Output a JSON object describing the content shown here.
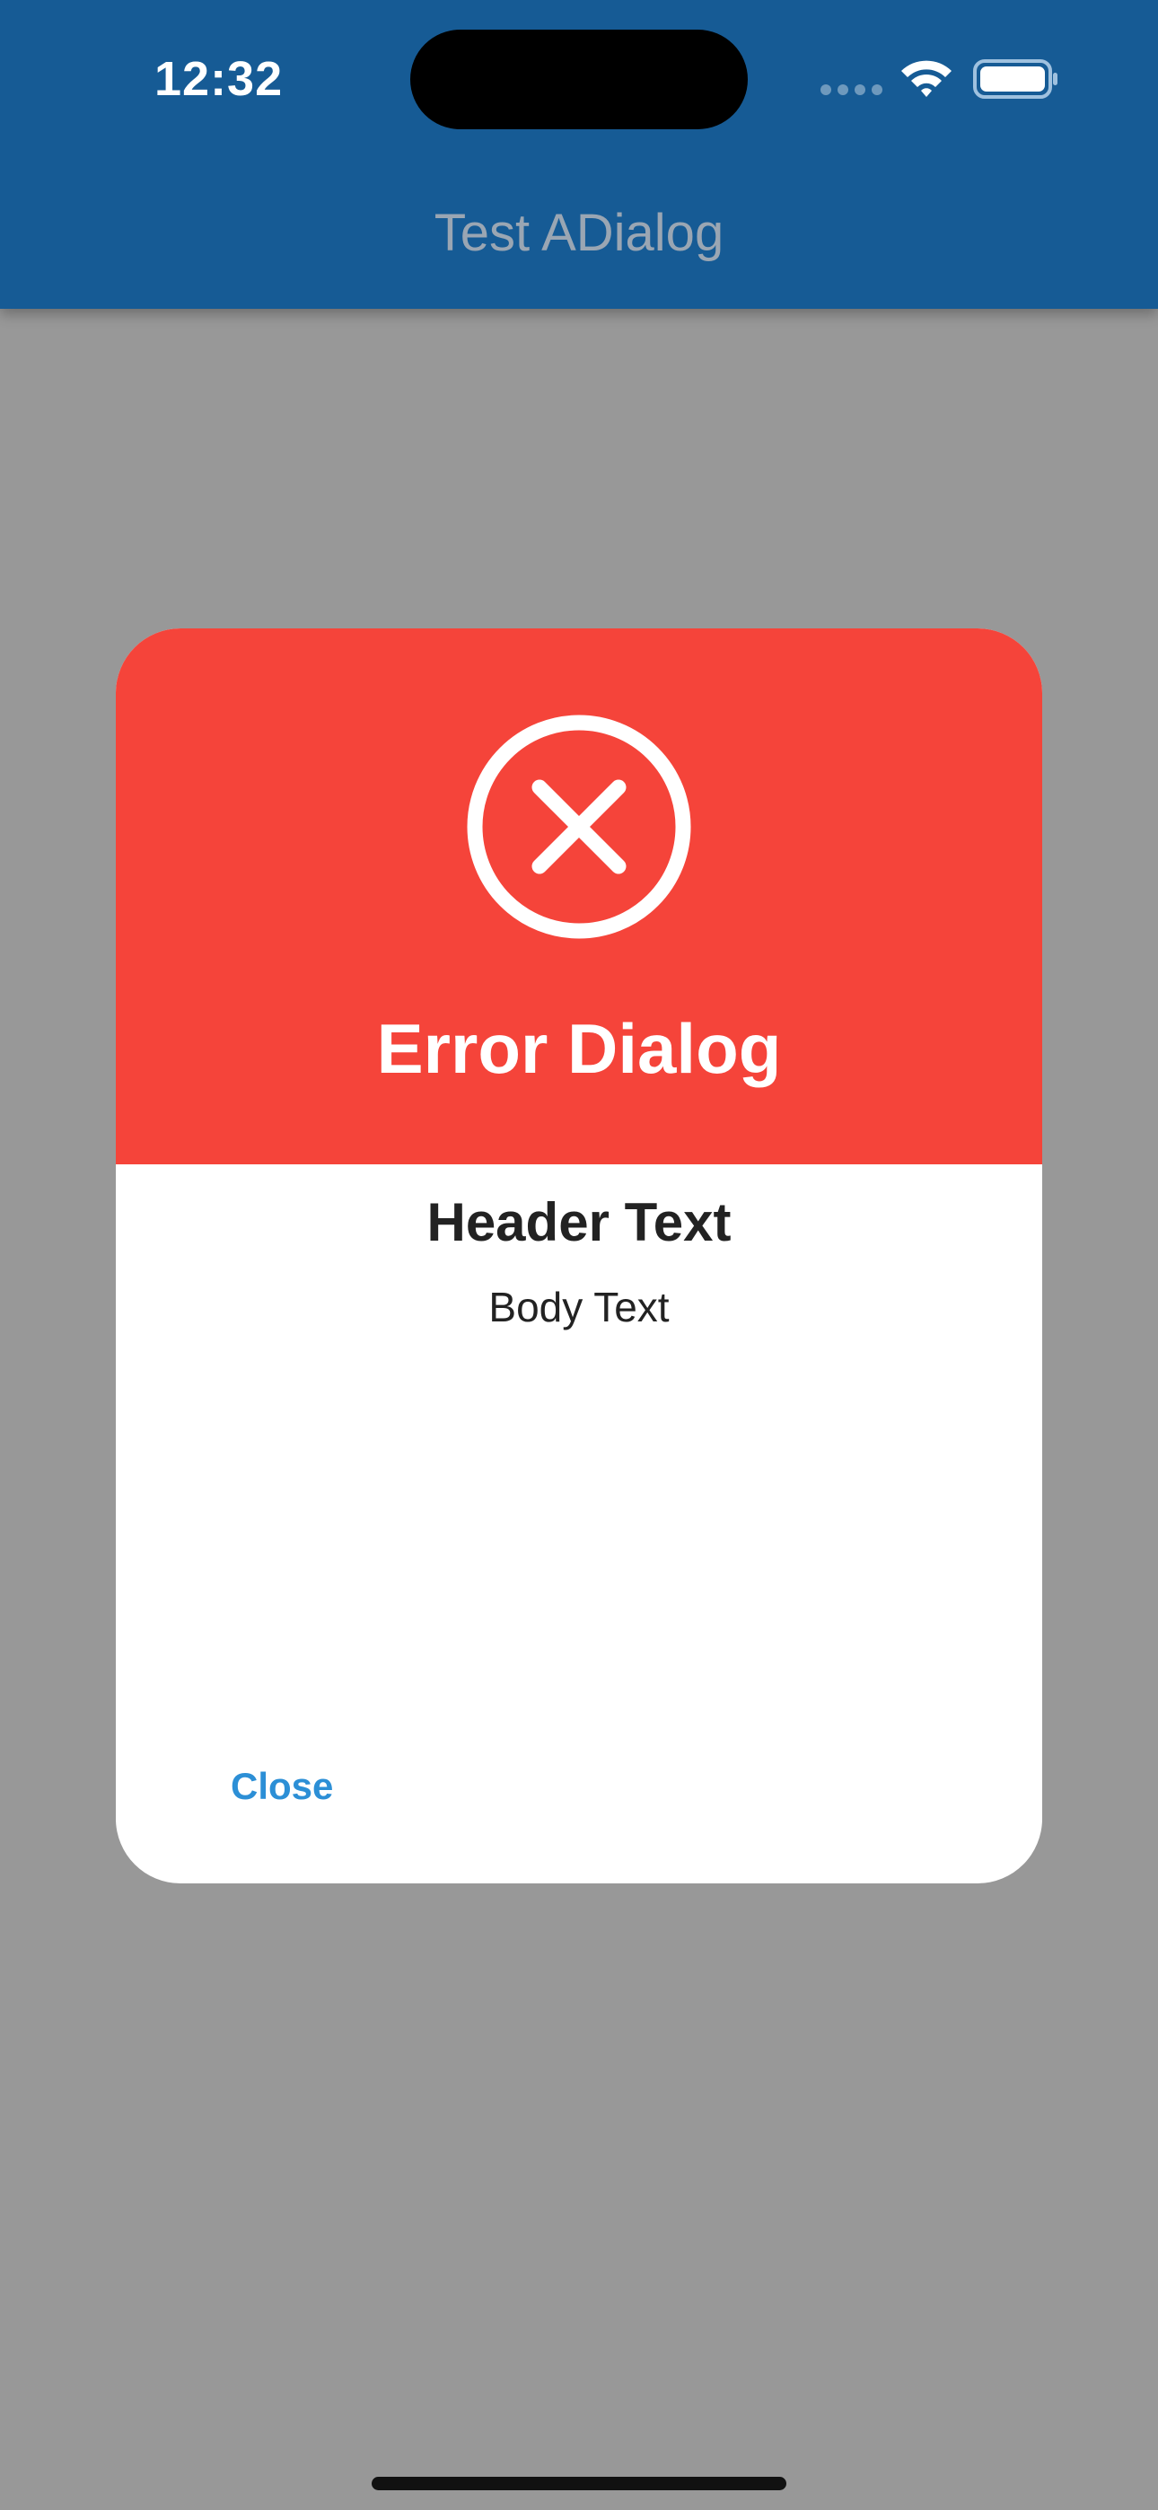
{
  "status_bar": {
    "time": "12:32"
  },
  "app_bar": {
    "title": "Test ADialog",
    "background_color": "#165b95"
  },
  "dialog": {
    "icon": "error-circle-x-icon",
    "title": "Error Dialog",
    "header": "Header Text",
    "body": "Body Text",
    "close_label": "Close",
    "hero_color": "#f5443a",
    "action_color": "#2c8fd6"
  },
  "overlay": {
    "color": "#989898"
  }
}
